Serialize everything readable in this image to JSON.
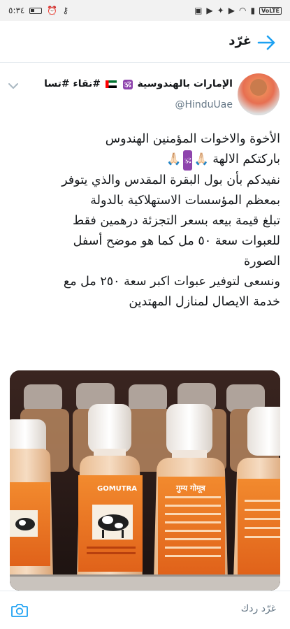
{
  "status_bar": {
    "time": "٥:٣٤",
    "right_icons": [
      "gallery-icon",
      "youtube-icon",
      "twitter-icon",
      "youtube-icon",
      "wifi-icon",
      "signal-icon",
      "volte-icon"
    ],
    "volte": "VoLTE"
  },
  "header": {
    "title": "غرّد"
  },
  "tweet": {
    "display_name_prefix": "الإمارات بالهندوسية",
    "om_badge": "🕉",
    "display_name_suffix": "#نقاء #تسام...",
    "handle": "@HinduUae",
    "text_lines": [
      "الأخوة والاخوات المؤمنين الهندوس",
      "باركتكم الالهة",
      "نفيدكم بأن بول البقرة المقدس والذي يتوفر",
      "بمعظم المؤسسات الاستهلاكية بالدولة",
      "تبلغ قيمة بيعه بسعر التجزئة درهمين فقط",
      "للعبوات سعة ٥٠ مل كما هو موضح أسفل",
      "الصورة",
      "ونسعى لتوفير عبوات اكبر سعة ٢٥٠ مل مع",
      "خدمة الايصال لمنازل المهتدين"
    ],
    "emoji_pray": "🙏🏻",
    "image": {
      "bottle_label_text": "GOMUTRA"
    }
  },
  "reply_bar": {
    "placeholder": "غرّد ردك"
  },
  "colors": {
    "accent": "#1da1f2",
    "text": "#14171a",
    "secondary": "#657786",
    "om_badge": "#8e44ad"
  }
}
